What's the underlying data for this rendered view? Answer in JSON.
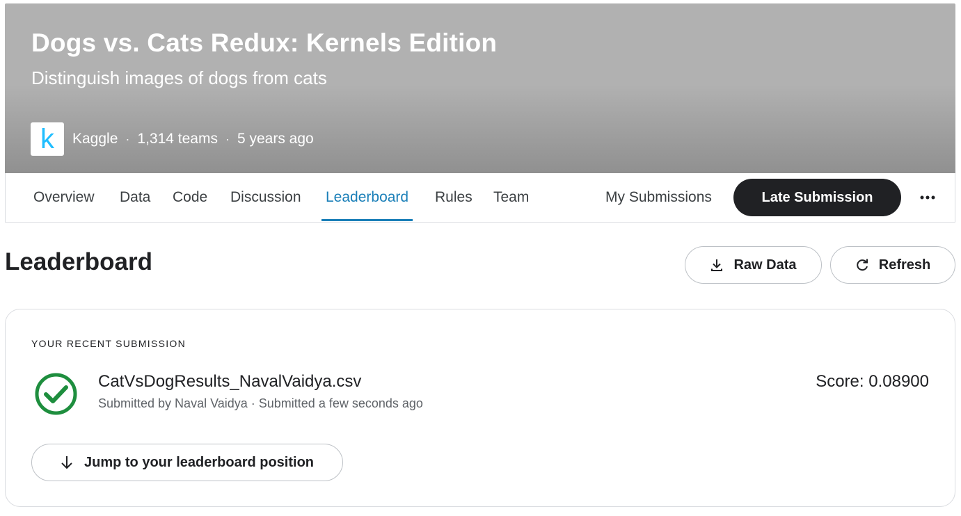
{
  "header": {
    "title": "Dogs vs. Cats Redux: Kernels Edition",
    "subtitle": "Distinguish images of dogs from cats",
    "host_logo_letter": "k",
    "host_name": "Kaggle",
    "teams": "1,314 teams",
    "age": "5 years ago",
    "separator": "·"
  },
  "tabs": {
    "overview": "Overview",
    "data": "Data",
    "code": "Code",
    "discussion": "Discussion",
    "leaderboard": "Leaderboard",
    "rules": "Rules",
    "team": "Team",
    "my_submissions": "My Submissions",
    "active": "Leaderboard"
  },
  "actions": {
    "late_submission": "Late Submission",
    "more_icon": "more-horizontal-icon"
  },
  "leaderboard": {
    "title": "Leaderboard",
    "raw_data_label": "Raw Data",
    "refresh_label": "Refresh"
  },
  "recent_submission": {
    "section_label": "YOUR RECENT SUBMISSION",
    "status_icon": "check-circle-icon",
    "file_name": "CatVsDogResults_NavalVaidya.csv",
    "meta": "Submitted by Naval Vaidya · Submitted a few seconds ago",
    "score": "Score: 0.08900",
    "jump_label": "Jump to your leaderboard position"
  },
  "colors": {
    "accent": "#1a7fb8",
    "success": "#1e8e3e",
    "dark_button": "#202124",
    "kaggle_blue": "#20beff"
  }
}
